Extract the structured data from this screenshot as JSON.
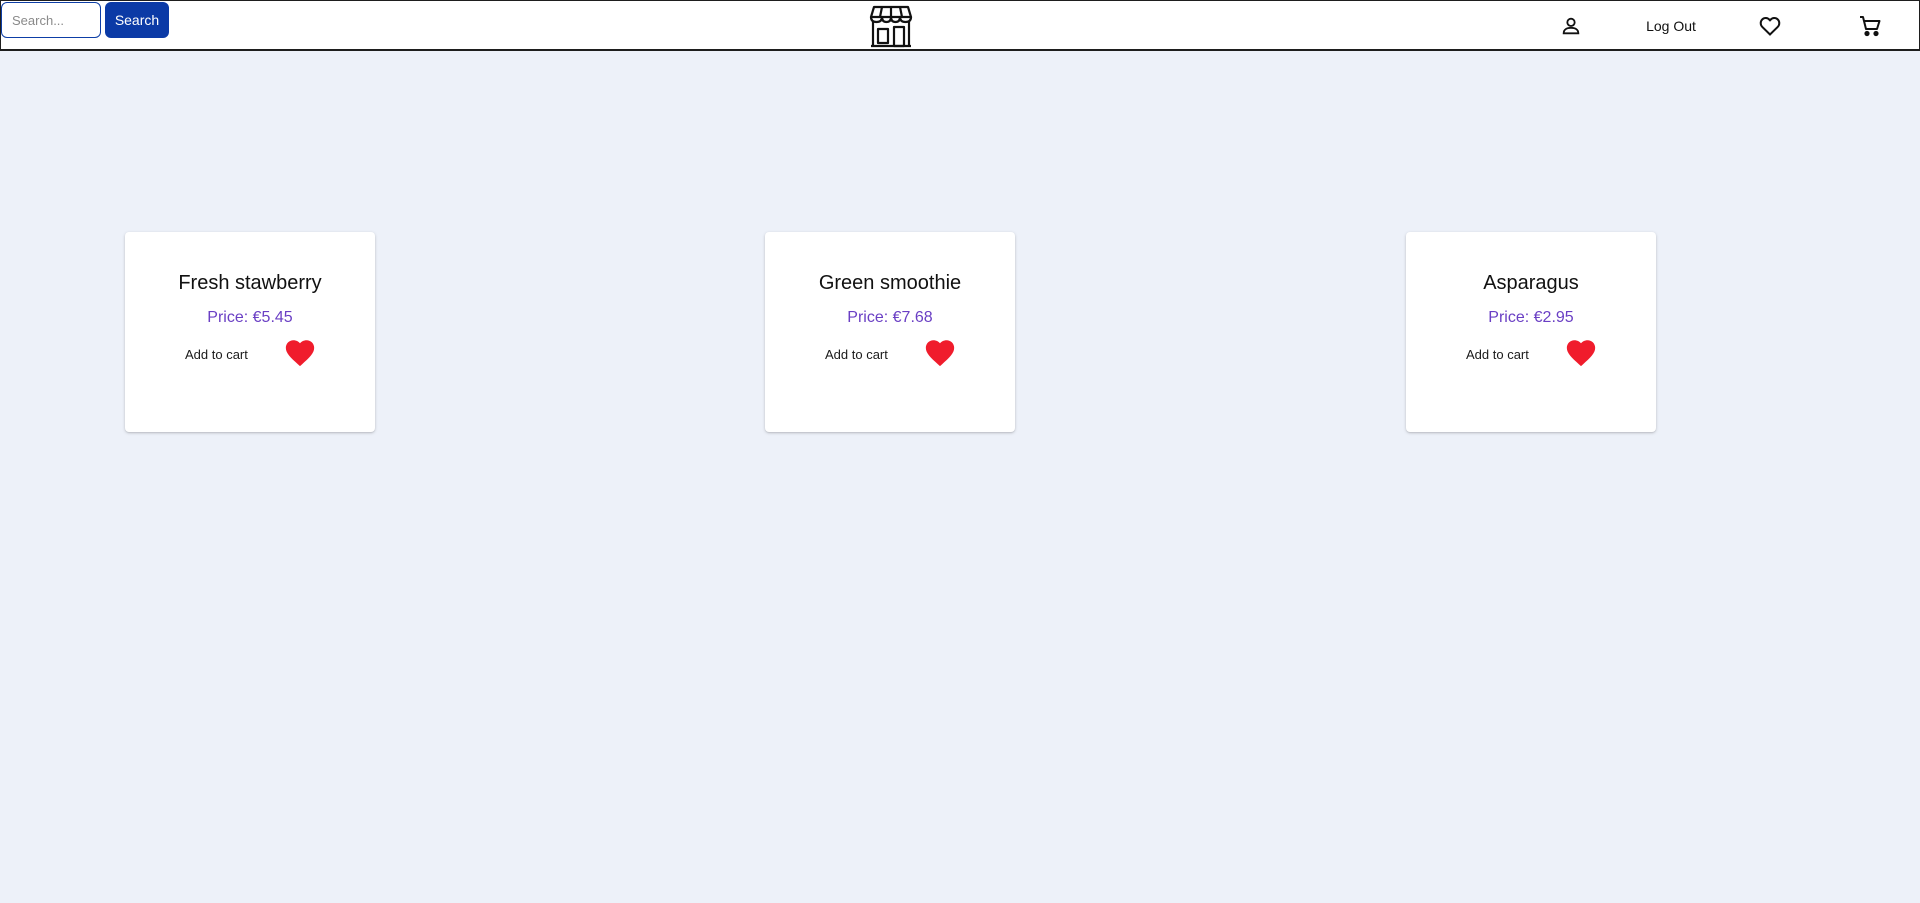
{
  "header": {
    "search_placeholder": "Search...",
    "search_label": "Search",
    "logo_icon": "storefront-icon",
    "user_icon": "user-icon",
    "logout_label": "Log Out",
    "favorites_icon": "heart-outline-icon",
    "cart_icon": "cart-icon"
  },
  "products": [
    {
      "name": "Fresh stawberry",
      "price": "Price: €5.45",
      "add_to_cart": "Add to cart",
      "favorite_icon": "heart-icon"
    },
    {
      "name": "Green smoothie",
      "price": "Price: €7.68",
      "add_to_cart": "Add to cart",
      "favorite_icon": "heart-icon"
    },
    {
      "name": "Asparagus",
      "price": "Price: €2.95",
      "add_to_cart": "Add to cart",
      "favorite_icon": "heart-icon"
    }
  ],
  "colors": {
    "background": "#edf1f9",
    "accent": "#0b3aa6",
    "price": "#6a3fc4",
    "heart": "#f01c2c"
  }
}
